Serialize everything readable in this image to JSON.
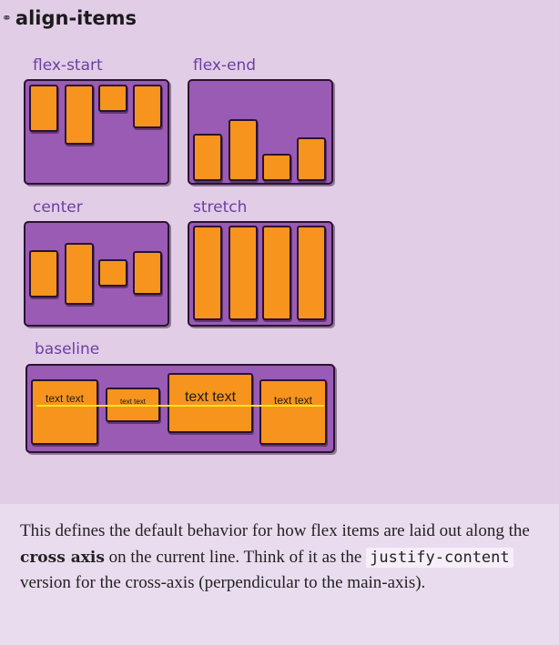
{
  "heading": {
    "icon": "link-icon",
    "title": "align-items"
  },
  "demos": {
    "flex_start": "flex-start",
    "flex_end": "flex-end",
    "center": "center",
    "stretch": "stretch",
    "baseline": "baseline",
    "baseline_texts": [
      "text text",
      "text text",
      "text text",
      "text text"
    ]
  },
  "description": {
    "part1": "This defines the default behavior for how flex items are laid out along the ",
    "bold": "cross axis",
    "part2": " on the current line. Think of it as the ",
    "code": "justify-content",
    "part3": " version for the cross-axis (perpendicular to the main-axis)."
  },
  "colors": {
    "container": "#9a5bb5",
    "item": "#f7941d",
    "baseline": "#f5e51b",
    "label": "#6b3fa0"
  }
}
